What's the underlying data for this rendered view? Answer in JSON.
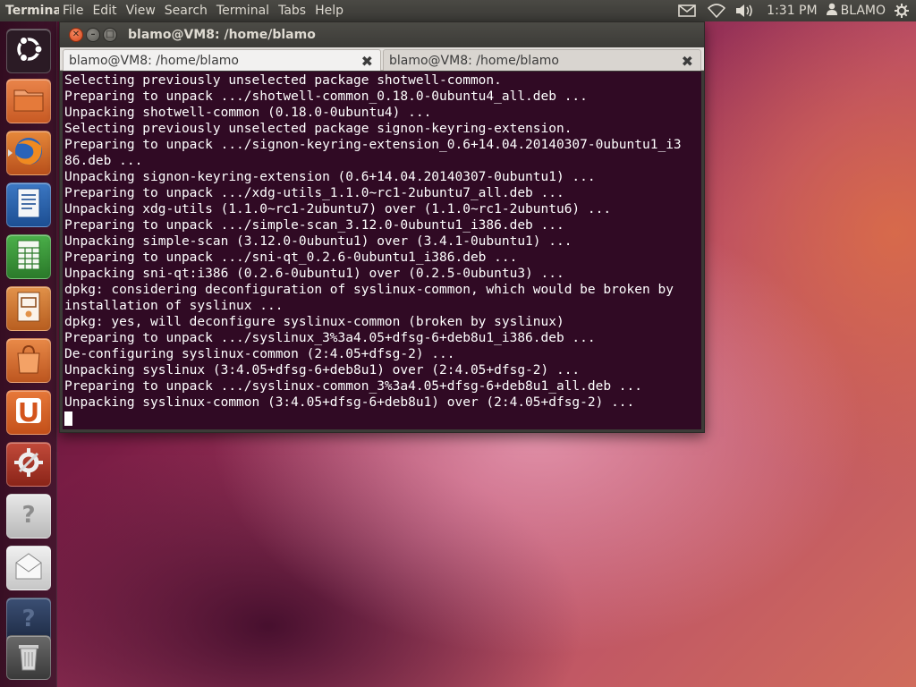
{
  "top_panel": {
    "app_title": "Terminal",
    "menus": [
      "File",
      "Edit",
      "View",
      "Search",
      "Terminal",
      "Tabs",
      "Help"
    ],
    "clock": "1:31 PM",
    "user": "BLAMO",
    "icons": [
      "mail-icon",
      "wifi-icon",
      "volume-icon",
      "user-icon",
      "gear-icon"
    ]
  },
  "launcher": {
    "items": [
      {
        "name": "dash-home",
        "icon": "ubuntu-logo-icon"
      },
      {
        "name": "files",
        "icon": "folder-icon"
      },
      {
        "name": "firefox",
        "icon": "firefox-icon"
      },
      {
        "name": "writer",
        "icon": "document-icon"
      },
      {
        "name": "calc",
        "icon": "spreadsheet-icon"
      },
      {
        "name": "impress",
        "icon": "presentation-icon"
      },
      {
        "name": "software-center",
        "icon": "shopping-bag-icon"
      },
      {
        "name": "ubuntu-one",
        "icon": "u-icon"
      },
      {
        "name": "system-settings",
        "icon": "settings-icon"
      },
      {
        "name": "unknown-app-1",
        "icon": "question-icon"
      },
      {
        "name": "mail-app",
        "icon": "envelope-icon"
      },
      {
        "name": "unknown-app-2",
        "icon": "question-icon"
      },
      {
        "name": "trash",
        "icon": "trash-icon"
      }
    ]
  },
  "window": {
    "title": "blamo@VM8: /home/blamo",
    "tabs": [
      {
        "label": "blamo@VM8: /home/blamo",
        "active": true
      },
      {
        "label": "blamo@VM8: /home/blamo",
        "active": false
      }
    ],
    "terminal_lines": [
      "Selecting previously unselected package shotwell-common.",
      "Preparing to unpack .../shotwell-common_0.18.0-0ubuntu4_all.deb ...",
      "Unpacking shotwell-common (0.18.0-0ubuntu4) ...",
      "Selecting previously unselected package signon-keyring-extension.",
      "Preparing to unpack .../signon-keyring-extension_0.6+14.04.20140307-0ubuntu1_i3",
      "86.deb ...",
      "Unpacking signon-keyring-extension (0.6+14.04.20140307-0ubuntu1) ...",
      "Preparing to unpack .../xdg-utils_1.1.0~rc1-2ubuntu7_all.deb ...",
      "Unpacking xdg-utils (1.1.0~rc1-2ubuntu7) over (1.1.0~rc1-2ubuntu6) ...",
      "Preparing to unpack .../simple-scan_3.12.0-0ubuntu1_i386.deb ...",
      "Unpacking simple-scan (3.12.0-0ubuntu1) over (3.4.1-0ubuntu1) ...",
      "Preparing to unpack .../sni-qt_0.2.6-0ubuntu1_i386.deb ...",
      "Unpacking sni-qt:i386 (0.2.6-0ubuntu1) over (0.2.5-0ubuntu3) ...",
      "dpkg: considering deconfiguration of syslinux-common, which would be broken by",
      "installation of syslinux ...",
      "dpkg: yes, will deconfigure syslinux-common (broken by syslinux)",
      "Preparing to unpack .../syslinux_3%3a4.05+dfsg-6+deb8u1_i386.deb ...",
      "De-configuring syslinux-common (2:4.05+dfsg-2) ...",
      "Unpacking syslinux (3:4.05+dfsg-6+deb8u1) over (2:4.05+dfsg-2) ...",
      "Preparing to unpack .../syslinux-common_3%3a4.05+dfsg-6+deb8u1_all.deb ...",
      "Unpacking syslinux-common (3:4.05+dfsg-6+deb8u1) over (2:4.05+dfsg-2) ..."
    ]
  },
  "colors": {
    "terminal_bg": "#300a24",
    "terminal_fg": "#ffffff",
    "panel_bg": "#3c3b37",
    "close_button": "#e0561f"
  }
}
